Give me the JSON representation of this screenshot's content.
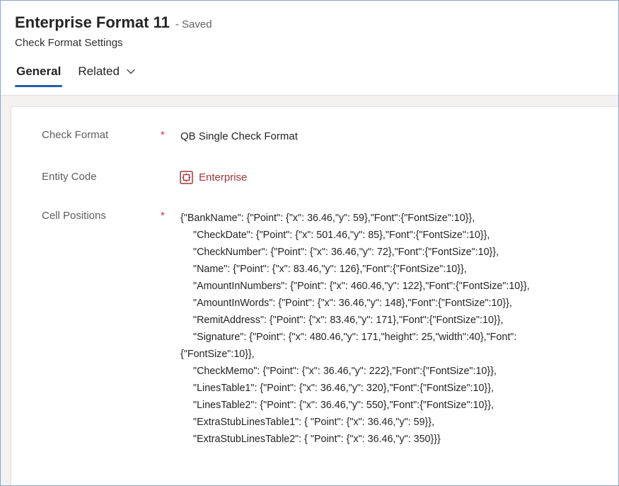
{
  "header": {
    "title": "Enterprise Format 11",
    "status": "- Saved",
    "subtitle": "Check Format Settings"
  },
  "tabs": [
    {
      "label": "General",
      "active": true
    },
    {
      "label": "Related",
      "active": false
    }
  ],
  "fields": {
    "check_format": {
      "label": "Check Format",
      "required": "*",
      "value": "QB Single Check Format"
    },
    "entity_code": {
      "label": "Entity Code",
      "value": "Enterprise",
      "icon": "entity-lookup-icon"
    },
    "cell_positions": {
      "label": "Cell Positions",
      "required": "*",
      "lines": [
        "{\"BankName\": {\"Point\": {\"x\": 36.46,\"y\": 59},\"Font\":{\"FontSize\":10}},",
        "\"CheckDate\": {\"Point\": {\"x\": 501.46,\"y\": 85},\"Font\":{\"FontSize\":10}},",
        "\"CheckNumber\": {\"Point\": {\"x\": 36.46,\"y\": 72},\"Font\":{\"FontSize\":10}},",
        "\"Name\": {\"Point\": {\"x\": 83.46,\"y\": 126},\"Font\":{\"FontSize\":10}},",
        "\"AmountInNumbers\": {\"Point\": {\"x\": 460.46,\"y\": 122},\"Font\":{\"FontSize\":10}},",
        "\"AmountInWords\": {\"Point\": {\"x\": 36.46,\"y\": 148},\"Font\":{\"FontSize\":10}},",
        "\"RemitAddress\": {\"Point\": {\"x\": 83.46,\"y\": 171},\"Font\":{\"FontSize\":10}},",
        "\"Signature\": {\"Point\": {\"x\": 480.46,\"y\": 171,\"height\": 25,\"width\":40},\"Font\":",
        "{\"FontSize\":10}},",
        "\"CheckMemo\": {\"Point\": {\"x\": 36.46,\"y\": 222},\"Font\":{\"FontSize\":10}},",
        "\"LinesTable1\": {\"Point\": {\"x\": 36.46,\"y\": 320},\"Font\":{\"FontSize\":10}},",
        "\"LinesTable2\": {\"Point\": {\"x\": 36.46,\"y\": 550},\"Font\":{\"FontSize\":10}},",
        "\"ExtraStubLinesTable1\": { \"Point\": {\"x\": 36.46,\"y\": 59}},",
        "\"ExtraStubLinesTable2\": { \"Point\": {\"x\": 36.46,\"y\": 350}}}"
      ]
    }
  },
  "icons": {
    "related_chevron": "chevron-down-icon"
  },
  "colors": {
    "accent": "#1f5fad",
    "required": "#c4314b",
    "lookup": "#a4373a"
  }
}
